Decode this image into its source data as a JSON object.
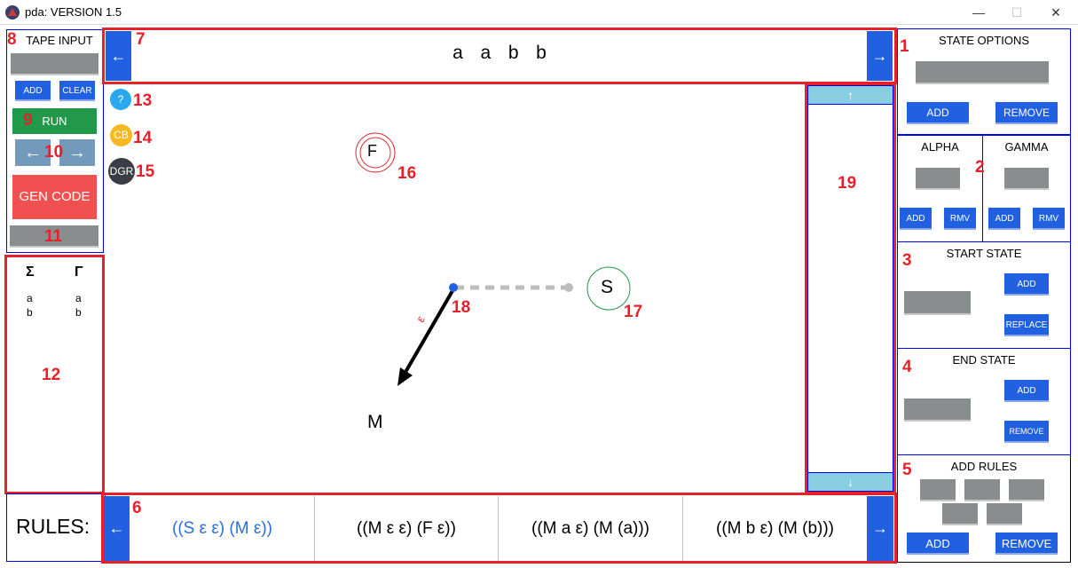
{
  "window": {
    "title": "pda: VERSION 1.5",
    "controls": {
      "minimize": "—",
      "maximize": "☐",
      "close": "✕"
    }
  },
  "left_panel": {
    "tape_input_label": "TAPE INPUT",
    "add_label": "ADD",
    "clear_label": "CLEAR",
    "run_label": "RUN",
    "gen_code_label": "GEN CODE",
    "prev_icon": "←",
    "next_icon": "→",
    "alphabet": {
      "sigma_header": "Σ",
      "gamma_header": "Γ",
      "sigma": [
        "a",
        "b"
      ],
      "gamma": [
        "a",
        "b"
      ]
    }
  },
  "tape": {
    "content": "a  a  b  b",
    "left_arrow": "←",
    "right_arrow": "→"
  },
  "canvas_buttons": {
    "help": "?",
    "cb": "CB",
    "dgr": "DGR"
  },
  "graph": {
    "states": [
      {
        "name": "F",
        "type": "final"
      },
      {
        "name": "S",
        "type": "start"
      },
      {
        "name": "M",
        "type": "normal"
      }
    ],
    "transition_label": "ε"
  },
  "stack_scroll": {
    "up": "↑",
    "down": "↓"
  },
  "rules": {
    "label": "RULES:",
    "left_arrow": "←",
    "right_arrow": "→",
    "items": [
      {
        "text": "((S ε ε) (M ε))",
        "highlighted": true
      },
      {
        "text": "((M ε ε) (F ε))",
        "highlighted": false
      },
      {
        "text": "((M a ε) (M (a)))",
        "highlighted": false
      },
      {
        "text": "((M b ε) (M (b)))",
        "highlighted": false
      }
    ]
  },
  "right_panel": {
    "state_options": {
      "title": "STATE OPTIONS",
      "add": "ADD",
      "remove": "REMOVE"
    },
    "alpha": {
      "title": "ALPHA",
      "add": "ADD",
      "rmv": "RMV"
    },
    "gamma": {
      "title": "GAMMA",
      "add": "ADD",
      "rmv": "RMV"
    },
    "start_state": {
      "title": "START STATE",
      "add": "ADD",
      "replace": "REPLACE"
    },
    "end_state": {
      "title": "END STATE",
      "add": "ADD",
      "remove": "REMOVE"
    },
    "add_rules": {
      "title": "ADD RULES",
      "add": "ADD",
      "remove": "REMOVE"
    }
  },
  "annotations": [
    "1",
    "2",
    "3",
    "4",
    "5",
    "6",
    "7",
    "8",
    "9",
    "10",
    "11",
    "12",
    "13",
    "14",
    "15",
    "16",
    "17",
    "18",
    "19"
  ],
  "colors": {
    "accent_blue": "#2160e0",
    "annotation_red": "#e8202a",
    "run_green": "#22994a",
    "gen_code_red": "#f05050",
    "field_gray": "#8a8d8d",
    "scroll_blue": "#88cde0"
  }
}
